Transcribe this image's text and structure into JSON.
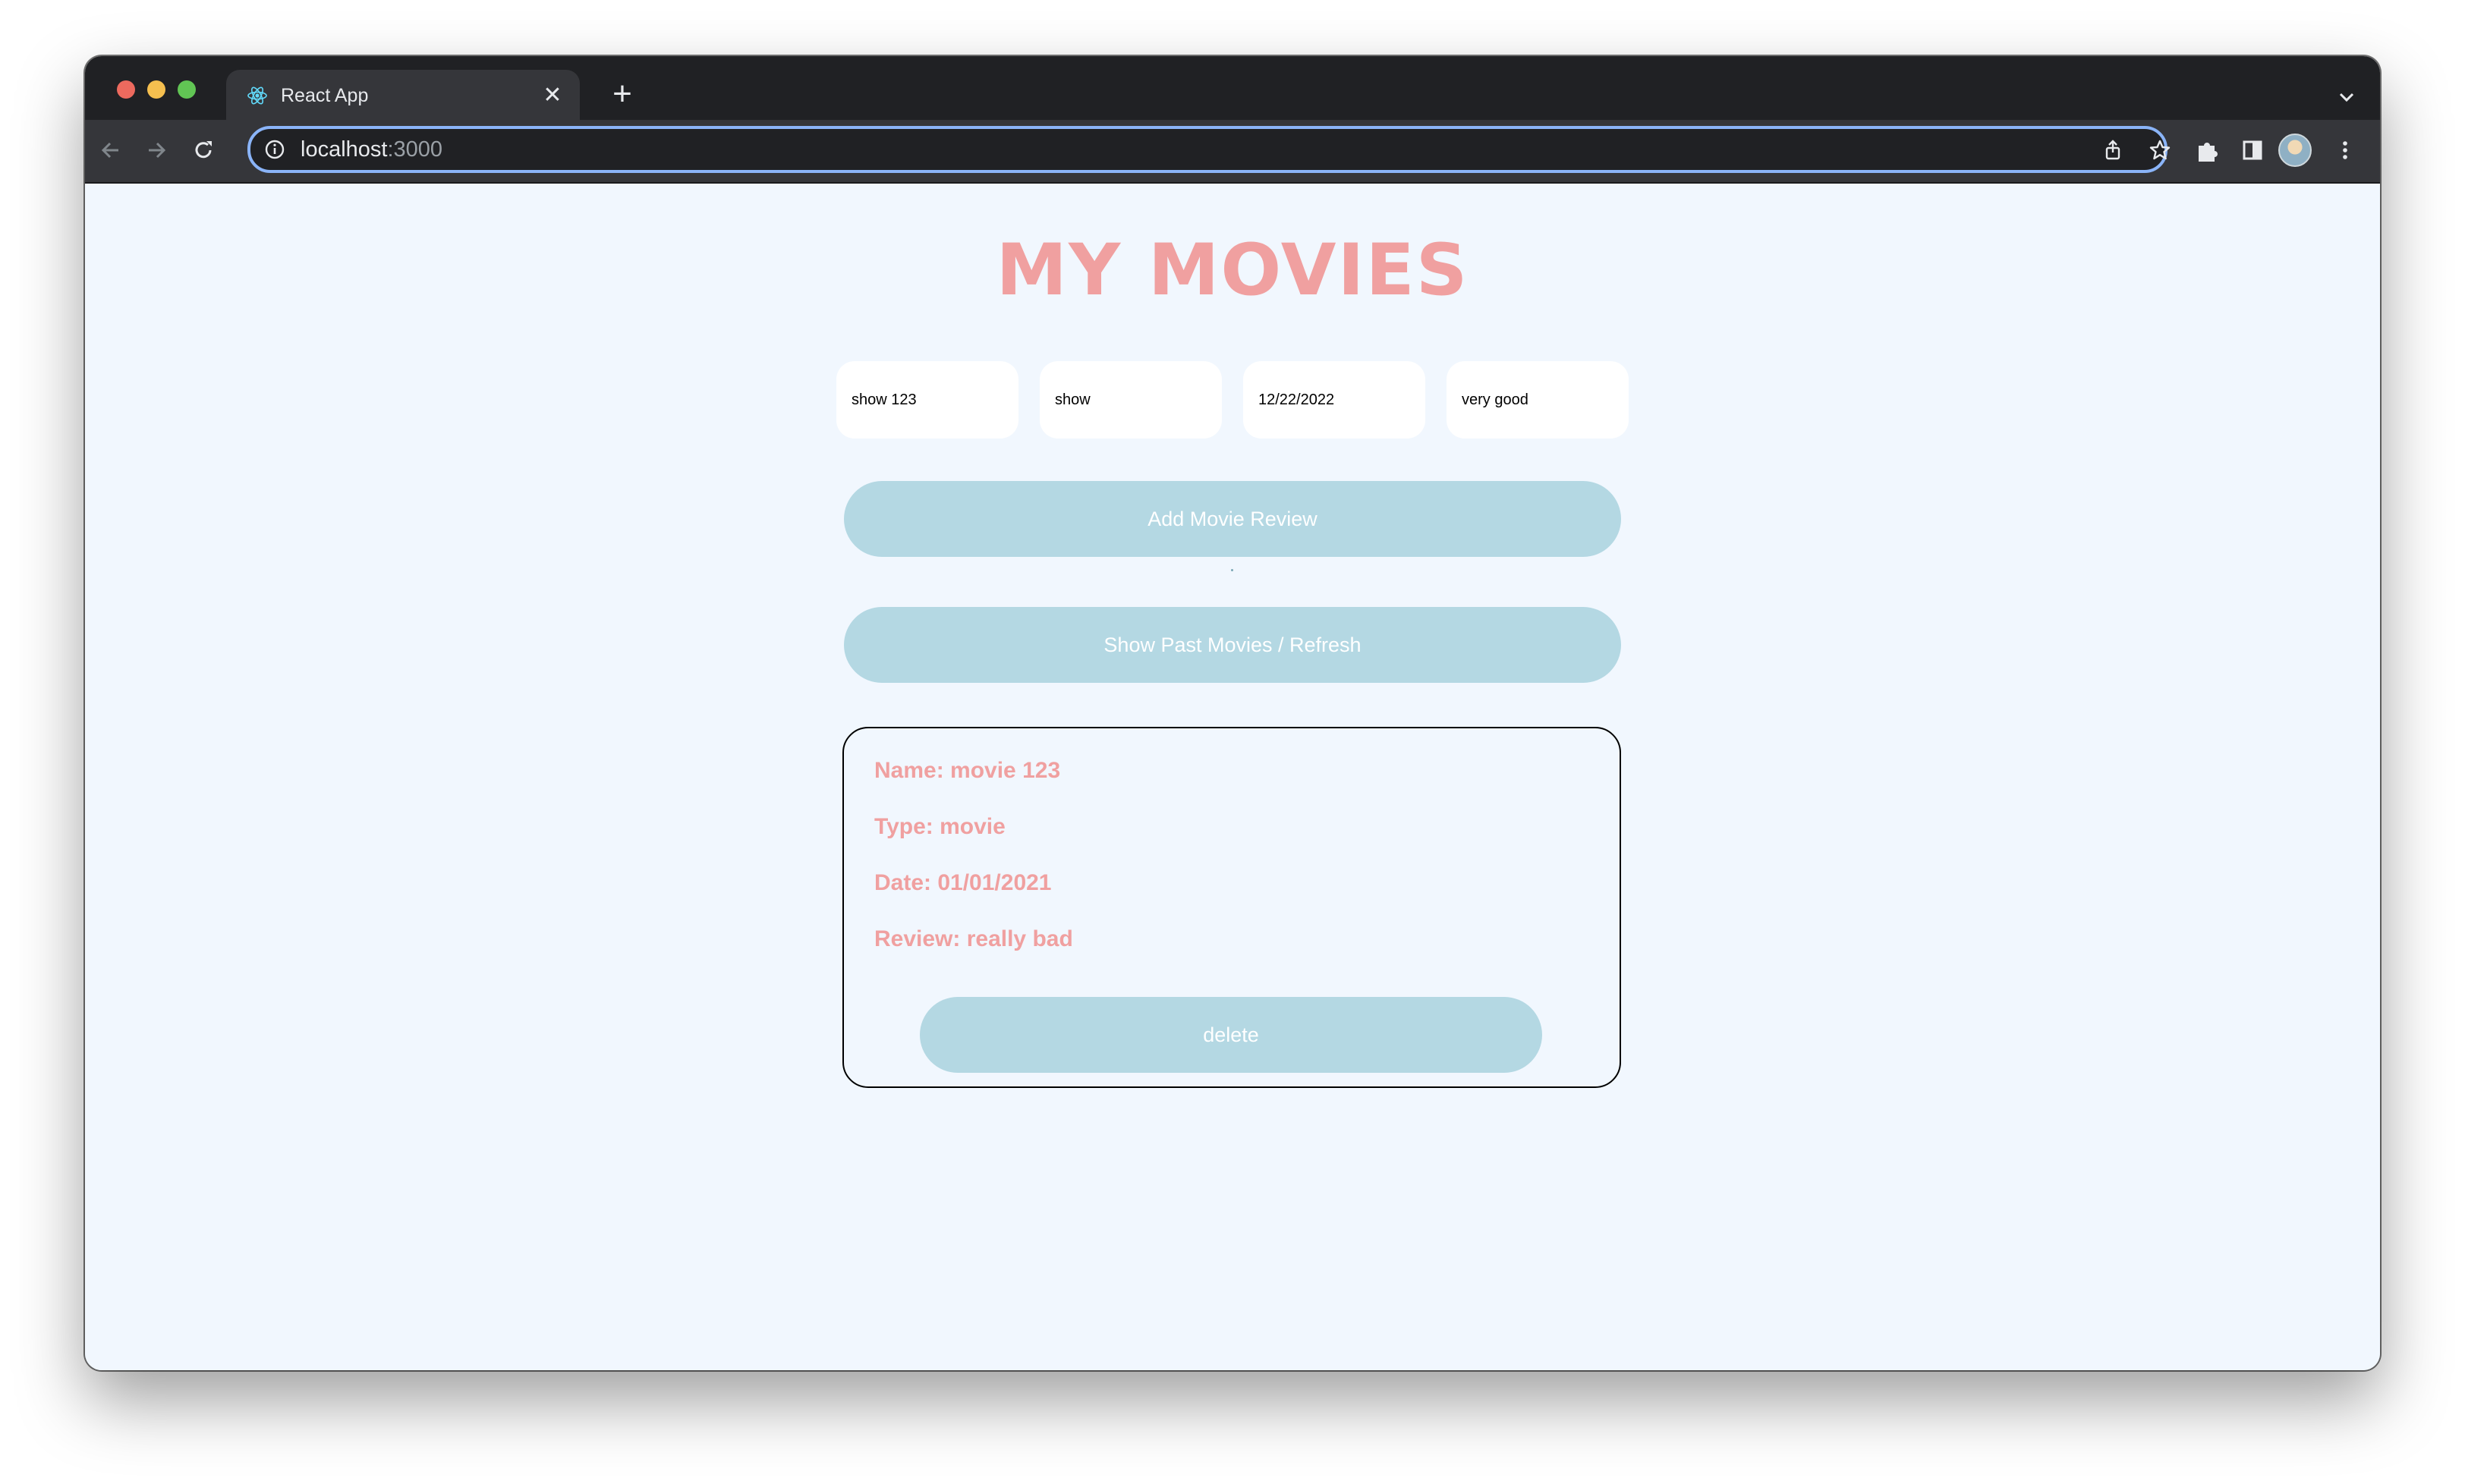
{
  "browser": {
    "tab_title": "React App",
    "url_host": "localhost",
    "url_port": ":3000"
  },
  "page": {
    "title": "MY MOVIES",
    "inputs": [
      {
        "value": "show 123"
      },
      {
        "value": "show"
      },
      {
        "value": "12/22/2022"
      },
      {
        "value": "very good"
      }
    ],
    "add_button_label": "Add Movie Review",
    "show_button_label": "Show Past Movies / Refresh",
    "reviews": [
      {
        "name_line": "Name: movie 123",
        "type_line": "Type: movie",
        "date_line": "Date: 01/01/2021",
        "review_line": "Review: really bad",
        "delete_label": "delete"
      }
    ]
  },
  "colors": {
    "title": "#f0a0a0",
    "button_bg": "#b4d8e3",
    "page_bg": "#f1f7fe",
    "card_text": "#f0a0a0"
  }
}
